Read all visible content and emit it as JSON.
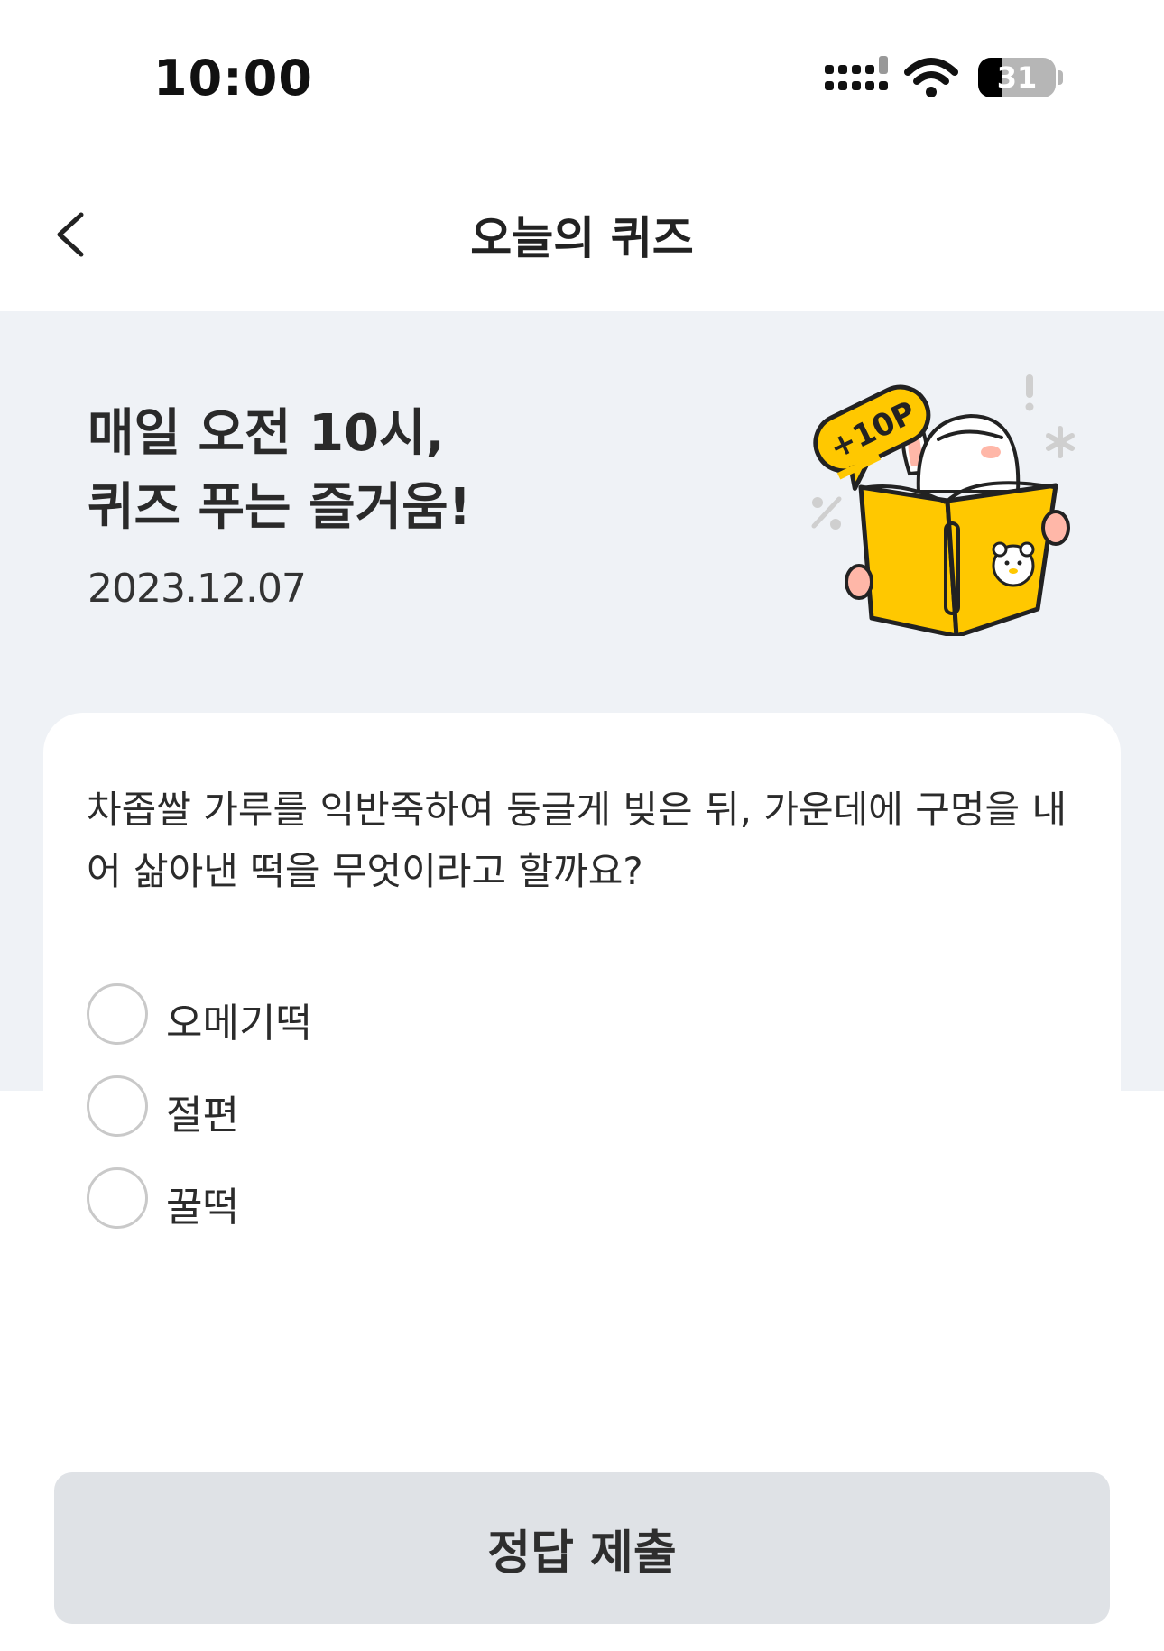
{
  "status_bar": {
    "time": "10:00",
    "battery_level": "31",
    "battery_fraction": 0.31,
    "icons": [
      "signal-icon",
      "wifi-icon",
      "battery-icon"
    ]
  },
  "nav": {
    "title": "오늘의 퀴즈",
    "back_icon": "chevron-left-icon"
  },
  "hero": {
    "title_line1": "매일 오전 10시,",
    "title_line2": "퀴즈 푸는 즐거움!",
    "date": "2023.12.07",
    "badge": "+10P"
  },
  "quiz": {
    "question": "차좁쌀 가루를 익반죽하여 둥글게 빚은 뒤, 가운데에 구멍을 내어 삶아낸 떡을 무엇이라고 할까요?",
    "options": [
      {
        "label": "오메기떡",
        "selected": false
      },
      {
        "label": "절편",
        "selected": false
      },
      {
        "label": "꿀떡",
        "selected": false
      }
    ]
  },
  "submit": {
    "label": "정답 제출"
  },
  "colors": {
    "hero_bg": "#eff2f6",
    "button_bg": "#dfe2e6",
    "book_yellow": "#ffc800",
    "text": "#2b2b2b"
  }
}
